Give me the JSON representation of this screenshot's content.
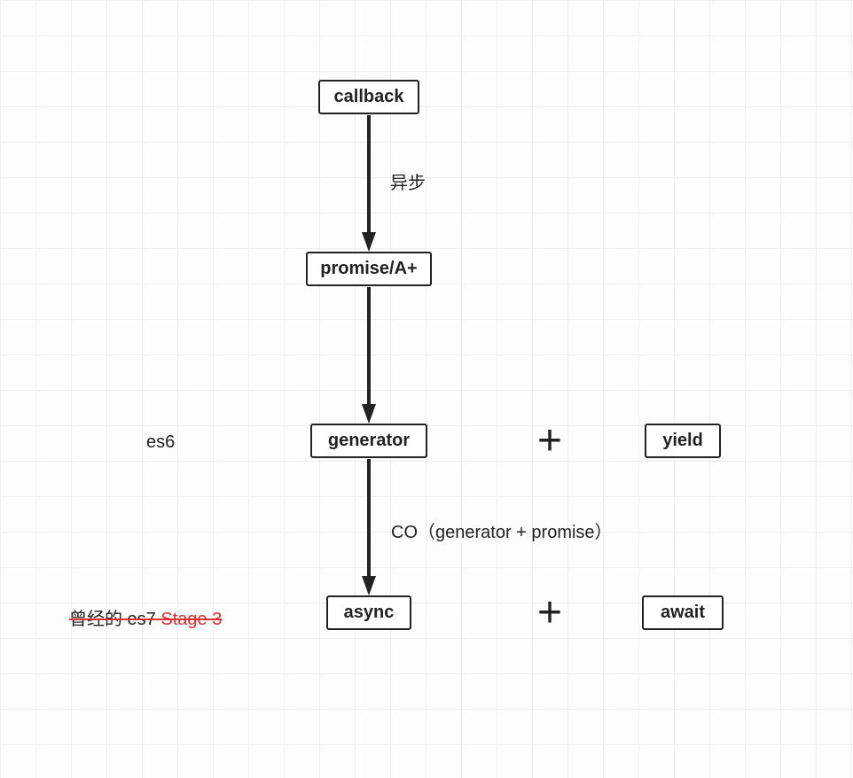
{
  "nodes": {
    "callback": "callback",
    "promise": "promise/A+",
    "generator": "generator",
    "yield": "yield",
    "async": "async",
    "await": "await"
  },
  "labels": {
    "async_cn": "异步",
    "es6": "es6",
    "co": "CO（generator + promise）",
    "es7_prefix": "曾经的 es7",
    "es7_stage": " Stage 3 "
  }
}
